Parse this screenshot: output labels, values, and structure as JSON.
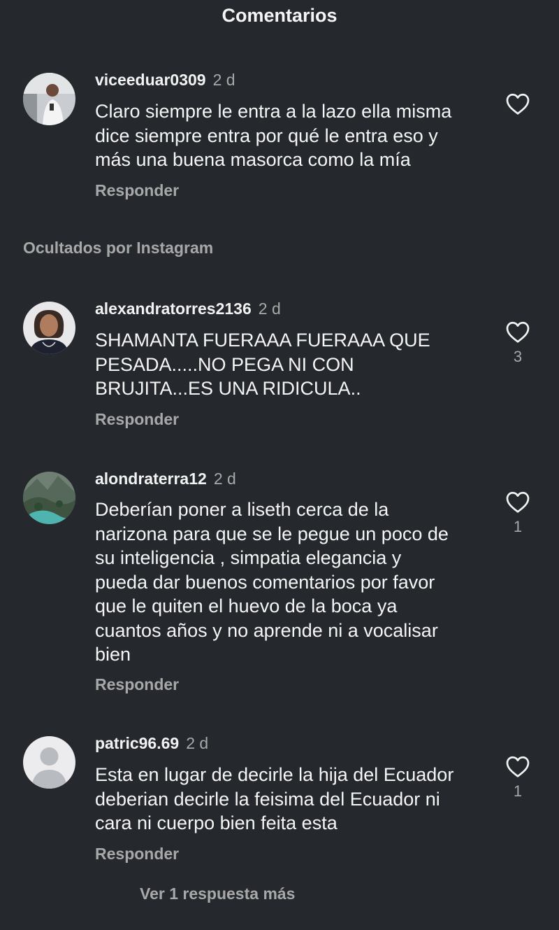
{
  "header": {
    "title": "Comentarios"
  },
  "hidden_section": {
    "label": "Ocultados por Instagram"
  },
  "comments": [
    {
      "username": "viceeduar0309",
      "time": "2 d",
      "text": "Claro siempre le entra  a la lazo ella misma\ndice siempre entra por qué le entra eso y\nmás una buena masorca como la mía",
      "reply_label": "Responder",
      "likes": "",
      "avatar": "photo"
    },
    {
      "username": "alexandratorres2136",
      "time": "2 d",
      "text": "SHAMANTA FUERAAA  FUERAAA  QUE\nPESADA.....NO  PEGA  NI  CON\nBRUJITA...ES  UNA  RIDICULA..",
      "reply_label": "Responder",
      "likes": "3",
      "avatar": "photo"
    },
    {
      "username": "alondraterra12",
      "time": "2 d",
      "text": "Deberían poner a liseth cerca de la\nnarizona para que se le pegue un poco de\nsu inteligencia , simpatia  elegancia y\npueda dar buenos comentarios por favor\nque le quiten el huevo de la boca ya\ncuantos años y no aprende ni a vocalisar\nbien",
      "reply_label": "Responder",
      "likes": "1",
      "avatar": "landscape"
    },
    {
      "username": "patric96.69",
      "time": "2 d",
      "text": "Esta en lugar de decirle la hija del Ecuador\ndeberian decirle la feisima del Ecuador ni\ncara ni cuerpo bien feita esta",
      "reply_label": "Responder",
      "likes": "1",
      "avatar": "default-user-icon"
    }
  ],
  "more_replies": {
    "label": "Ver 1 respuesta más"
  },
  "colors": {
    "background": "#25292e",
    "text": "#f5f5f5",
    "muted": "#a8a8a8"
  }
}
